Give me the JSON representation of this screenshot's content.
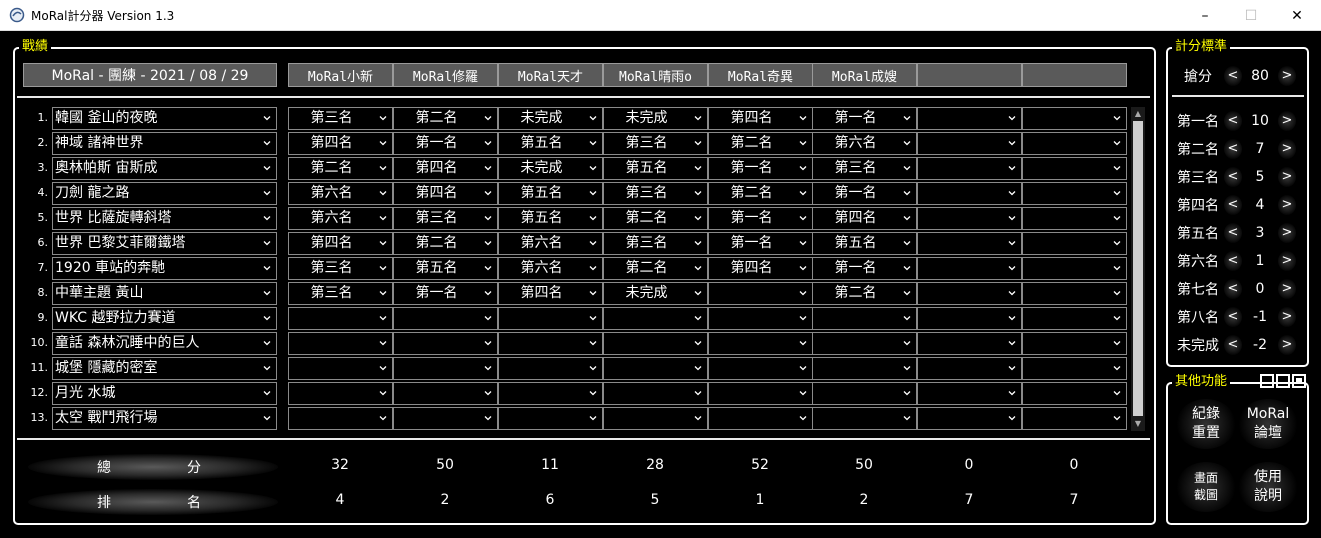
{
  "window": {
    "title": "MoRal計分器 Version 1.3",
    "controls": [
      "–",
      "☐",
      "✕"
    ]
  },
  "groups": {
    "record": "戰績",
    "scoring": "計分標準",
    "other": "其他功能"
  },
  "header": {
    "track_title": "MoRal - 團練 - 2021 / 08 / 29",
    "players": [
      "MoRal小新",
      "MoRal修羅",
      "MoRal天才",
      "MoRal晴雨o",
      "MoRal奇異",
      "MoRal成嫂",
      "",
      ""
    ]
  },
  "races": [
    {
      "num": "1.",
      "track": "韓國 釜山的夜晚",
      "ranks": [
        "第三名",
        "第二名",
        "未完成",
        "未完成",
        "第四名",
        "第一名",
        "",
        ""
      ]
    },
    {
      "num": "2.",
      "track": "神域 諸神世界",
      "ranks": [
        "第四名",
        "第一名",
        "第五名",
        "第三名",
        "第二名",
        "第六名",
        "",
        ""
      ]
    },
    {
      "num": "3.",
      "track": "奧林帕斯 宙斯成",
      "ranks": [
        "第二名",
        "第四名",
        "未完成",
        "第五名",
        "第一名",
        "第三名",
        "",
        ""
      ]
    },
    {
      "num": "4.",
      "track": "刀劍 龍之路",
      "ranks": [
        "第六名",
        "第四名",
        "第五名",
        "第三名",
        "第二名",
        "第一名",
        "",
        ""
      ]
    },
    {
      "num": "5.",
      "track": "世界 比薩旋轉斜塔",
      "ranks": [
        "第六名",
        "第三名",
        "第五名",
        "第二名",
        "第一名",
        "第四名",
        "",
        ""
      ]
    },
    {
      "num": "6.",
      "track": "世界 巴黎艾菲爾鐵塔",
      "ranks": [
        "第四名",
        "第二名",
        "第六名",
        "第三名",
        "第一名",
        "第五名",
        "",
        ""
      ]
    },
    {
      "num": "7.",
      "track": "1920 車站的奔馳",
      "ranks": [
        "第三名",
        "第五名",
        "第六名",
        "第二名",
        "第四名",
        "第一名",
        "",
        ""
      ]
    },
    {
      "num": "8.",
      "track": "中華主題 黃山",
      "ranks": [
        "第三名",
        "第一名",
        "第四名",
        "未完成",
        "",
        "第二名",
        "",
        ""
      ]
    },
    {
      "num": "9.",
      "track": "WKC 越野拉力賽道",
      "ranks": [
        "",
        "",
        "",
        "",
        "",
        "",
        "",
        ""
      ]
    },
    {
      "num": "10.",
      "track": "童話 森林沉睡中的巨人",
      "ranks": [
        "",
        "",
        "",
        "",
        "",
        "",
        "",
        ""
      ]
    },
    {
      "num": "11.",
      "track": "城堡 隱藏的密室",
      "ranks": [
        "",
        "",
        "",
        "",
        "",
        "",
        "",
        ""
      ]
    },
    {
      "num": "12.",
      "track": "月光 水城",
      "ranks": [
        "",
        "",
        "",
        "",
        "",
        "",
        "",
        ""
      ]
    },
    {
      "num": "13.",
      "track": "太空 戰鬥飛行場",
      "ranks": [
        "",
        "",
        "",
        "",
        "",
        "",
        "",
        ""
      ]
    }
  ],
  "summary": {
    "total_label_a": "總",
    "total_label_b": "分",
    "rank_label_a": "排",
    "rank_label_b": "名",
    "totals": [
      "32",
      "50",
      "11",
      "28",
      "52",
      "50",
      "0",
      "0"
    ],
    "ranks": [
      "4",
      "2",
      "6",
      "5",
      "1",
      "2",
      "7",
      "7"
    ]
  },
  "scoring": {
    "prev": "<",
    "next": ">",
    "grab": {
      "label": "搶分",
      "value": "80"
    },
    "rows": [
      {
        "label": "第一名",
        "value": "10"
      },
      {
        "label": "第二名",
        "value": "7"
      },
      {
        "label": "第三名",
        "value": "5"
      },
      {
        "label": "第四名",
        "value": "4"
      },
      {
        "label": "第五名",
        "value": "3"
      },
      {
        "label": "第六名",
        "value": "1"
      },
      {
        "label": "第七名",
        "value": "0"
      },
      {
        "label": "第八名",
        "value": "-1"
      },
      {
        "label": "未完成",
        "value": "-2"
      }
    ]
  },
  "other": {
    "reset": [
      "紀錄",
      "重置"
    ],
    "forum": [
      "MoRal",
      "論壇"
    ],
    "screenshot": [
      "畫面",
      "截圖"
    ],
    "help": [
      "使用",
      "說明"
    ]
  },
  "colors": {
    "background": "#000000",
    "legend": "#ffff00",
    "header_bg": "#5a5a5a",
    "border": "#ffffff"
  }
}
